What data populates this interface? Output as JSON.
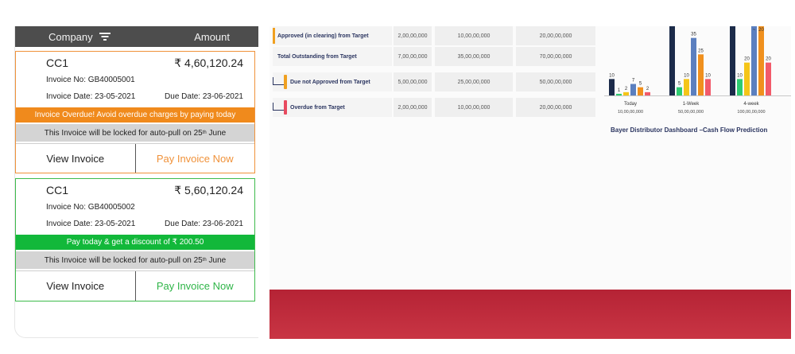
{
  "invoice_list": {
    "header": {
      "company_label": "Company",
      "amount_label": "Amount"
    },
    "cards": [
      {
        "company": "CC1",
        "amount": "₹ 4,60,120.24",
        "invoice_no": "Invoice No: GB40005001",
        "invoice_date": "Invoice Date: 23-05-2021",
        "due_date": "Due Date: 23-06-2021",
        "banner": "Invoice Overdue! Avoid overdue charges by paying today",
        "lock_prefix": "This Invoice will be locked for auto-pull on 25",
        "lock_sup": "th",
        "lock_suffix": " June",
        "view_label": "View Invoice",
        "pay_label": "Pay Invoice Now"
      },
      {
        "company": "CC1",
        "amount": "₹ 5,60,120.24",
        "invoice_no": "Invoice No: GB40005002",
        "invoice_date": "Invoice Date: 23-05-2021",
        "due_date": "Due Date: 23-06-2021",
        "banner": "Pay today & get a discount of ₹ 200.50",
        "lock_prefix": "This Invoice will be locked for auto-pull on 25",
        "lock_sup": "th",
        "lock_suffix": " June",
        "view_label": "View Invoice",
        "pay_label": "Pay Invoice Now"
      }
    ]
  },
  "dashboard": {
    "table": [
      {
        "label": "Approved (in clearing) from Target",
        "v1": "2,00,00,000",
        "v2": "10,00,00,000",
        "v3": "20,00,00,000"
      },
      {
        "label": "Total Outstanding from Target",
        "v1": "7,00,00,000",
        "v2": "35,00,00,000",
        "v3": "70,00,00,000"
      },
      {
        "label": "Due not Approved from Target",
        "v1": "5,00,00,000",
        "v2": "25,00,00,000",
        "v3": "50,00,00,000"
      },
      {
        "label": "Overdue from Target",
        "v1": "2,00,00,000",
        "v2": "10,00,00,000",
        "v3": "20,00,00,000"
      }
    ],
    "marker_colors": {
      "approved": "#f0a020",
      "due": "#f0a020",
      "overdue": "#e84a5f"
    },
    "chart_caption": "Bayer Distributor Dashboard –Cash Flow Prediction"
  },
  "chart_data": {
    "type": "bar",
    "categories": [
      "Today",
      "1-Week",
      "4-week"
    ],
    "category_subtitles": [
      "10,00,00,000",
      "50,00,00,000",
      "100,00,00,000"
    ],
    "colors": [
      "#1c2b4a",
      "#2ecc71",
      "#f5c518",
      "#5b7fbf",
      "#f0901e",
      "#f25a6a"
    ],
    "values": [
      [
        10,
        1,
        2,
        7,
        5,
        2
      ],
      [
        null,
        5,
        10,
        35,
        25,
        10
      ],
      [
        null,
        10,
        20,
        null,
        null,
        20
      ]
    ],
    "labels": [
      [
        "10",
        "1",
        "2",
        "7",
        "5",
        "2"
      ],
      [
        "~",
        "5",
        "10",
        "35",
        "25",
        "10"
      ],
      [
        "~",
        "10",
        "20",
        "~",
        "20",
        "20"
      ]
    ],
    "ylim": [
      0,
      40
    ]
  }
}
